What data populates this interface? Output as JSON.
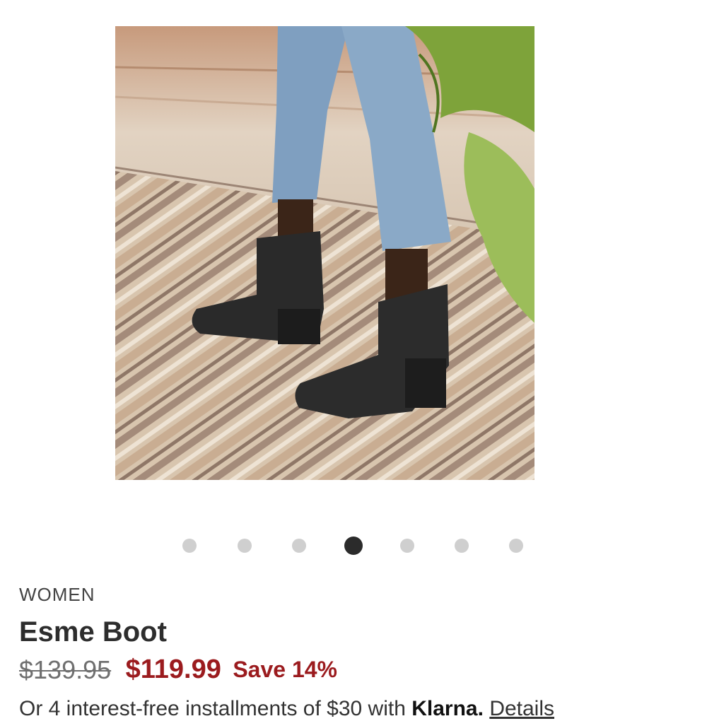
{
  "gallery": {
    "image_alt": "Model wearing black Esme ankle boots with cropped jeans on a striped rug",
    "dot_count": 7,
    "active_index": 3
  },
  "product": {
    "category": "WOMEN",
    "title": "Esme Boot",
    "original_price": "$139.95",
    "sale_price": "$119.99",
    "savings": "Save 14%"
  },
  "financing": {
    "prefix": "Or 4 interest-free installments of $30 with",
    "provider": "Klarna.",
    "details_link": "Details"
  },
  "colors": {
    "sale": "#9b1b1e",
    "active_dot": "#2b2b2b",
    "inactive_dot": "#cfcfcf"
  }
}
